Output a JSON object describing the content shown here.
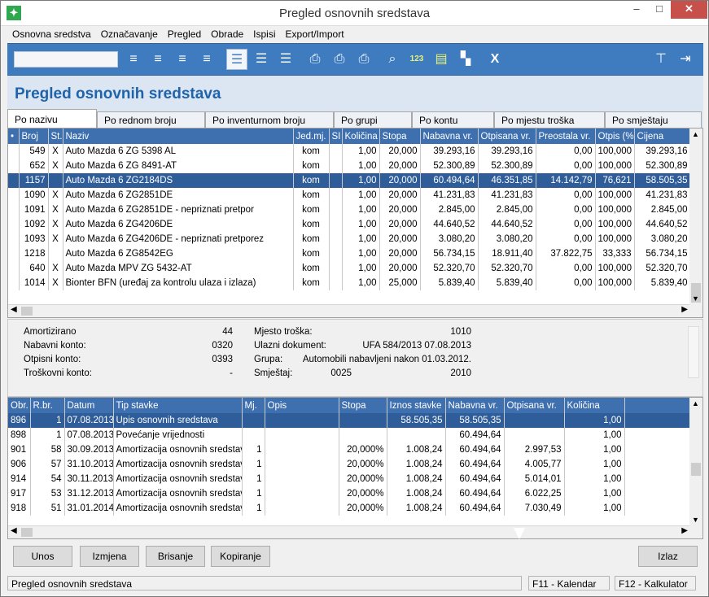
{
  "window": {
    "title": "Pregled osnovnih sredstava",
    "minimize": "–",
    "maximize": "□",
    "close": "✕"
  },
  "menu": [
    "Osnovna sredstva",
    "Označavanje",
    "Pregled",
    "Obrade",
    "Ispisi",
    "Export/Import"
  ],
  "toolbar": {
    "search_value": "",
    "icons": [
      "list-insert-icon",
      "list-add-icon",
      "list-delete-icon",
      "list-refresh-icon",
      "view-detail-icon",
      "view-list-icon",
      "view-compact-icon",
      "print-icon",
      "print-euro-icon",
      "print-sum-icon",
      "search-icon",
      "number-123-icon",
      "document-icon",
      "layout-icon",
      "excel-icon",
      "settings-icon",
      "exit-icon"
    ],
    "number_label": "123",
    "excel_label": "X"
  },
  "page_title": "Pregled osnovnih sredstava",
  "tabs": [
    {
      "label": "Po nazivu",
      "hotkey_index": 0,
      "active": true
    },
    {
      "label": "Po rednom broju",
      "active": false
    },
    {
      "label": "Po inventurnom broju",
      "active": false
    },
    {
      "label": "Po grupi",
      "active": false
    },
    {
      "label": "Po kontu",
      "active": false
    },
    {
      "label": "Po mjestu troška",
      "active": false
    },
    {
      "label": "Po smještaju",
      "active": false
    }
  ],
  "grid": {
    "columns": [
      "•",
      "Broj",
      "St.",
      "Naziv",
      "Jed.mj.",
      "SI",
      "Količina",
      "Stopa",
      "Nabavna vr.",
      "Otpisana vr.",
      "Preostala vr.",
      "Otpis (%)",
      "Cijena"
    ],
    "rows": [
      [
        "",
        "549",
        "X",
        "Auto Mazda 6 ZG 5398 AL",
        "kom",
        "",
        "1,00",
        "20,000",
        "39.293,16",
        "39.293,16",
        "0,00",
        "100,000",
        "39.293,16"
      ],
      [
        "",
        "652",
        "X",
        "Auto Mazda 6 ZG 8491-AT",
        "kom",
        "",
        "1,00",
        "20,000",
        "52.300,89",
        "52.300,89",
        "0,00",
        "100,000",
        "52.300,89"
      ],
      [
        "",
        "1157",
        "",
        "Auto Mazda 6 ZG2184DS",
        "kom",
        "",
        "1,00",
        "20,000",
        "60.494,64",
        "46.351,85",
        "14.142,79",
        "76,621",
        "58.505,35"
      ],
      [
        "",
        "1090",
        "X",
        "Auto Mazda 6 ZG2851DE",
        "kom",
        "",
        "1,00",
        "20,000",
        "41.231,83",
        "41.231,83",
        "0,00",
        "100,000",
        "41.231,83"
      ],
      [
        "",
        "1091",
        "X",
        "Auto Mazda 6 ZG2851DE - nepriznati pretpor",
        "kom",
        "",
        "1,00",
        "20,000",
        "2.845,00",
        "2.845,00",
        "0,00",
        "100,000",
        "2.845,00"
      ],
      [
        "",
        "1092",
        "X",
        "Auto Mazda 6 ZG4206DE",
        "kom",
        "",
        "1,00",
        "20,000",
        "44.640,52",
        "44.640,52",
        "0,00",
        "100,000",
        "44.640,52"
      ],
      [
        "",
        "1093",
        "X",
        "Auto Mazda 6 ZG4206DE - nepriznati pretporez",
        "kom",
        "",
        "1,00",
        "20,000",
        "3.080,20",
        "3.080,20",
        "0,00",
        "100,000",
        "3.080,20"
      ],
      [
        "",
        "1218",
        "",
        "Auto Mazda 6 ZG8542EG",
        "kom",
        "",
        "1,00",
        "20,000",
        "56.734,15",
        "18.911,40",
        "37.822,75",
        "33,333",
        "56.734,15"
      ],
      [
        "",
        "640",
        "X",
        "Auto Mazda MPV ZG 5432-AT",
        "kom",
        "",
        "1,00",
        "20,000",
        "52.320,70",
        "52.320,70",
        "0,00",
        "100,000",
        "52.320,70"
      ],
      [
        "",
        "1014",
        "X",
        "Bionter BFN (uređaj za kontrolu ulaza i izlaza)",
        "kom",
        "",
        "1,00",
        "25,000",
        "5.839,40",
        "5.839,40",
        "0,00",
        "100,000",
        "5.839,40"
      ]
    ],
    "selected_row": 2
  },
  "detail": {
    "left": [
      {
        "label": "Amortizirano",
        "value": "44"
      },
      {
        "label": "Nabavni konto:",
        "value": "0320"
      },
      {
        "label": "Otpisni konto:",
        "value": "0393"
      },
      {
        "label": "Troškovni konto:",
        "value": "-"
      }
    ],
    "mjesto_label": "Mjesto troška:",
    "mjesto_value": "1010",
    "ulazni_label": "Ulazni dokument:",
    "ulazni_value": "UFA 584/2013  07.08.2013",
    "grupa_label": "Grupa:",
    "grupa_value": "Automobili nabavljeni nakon 01.03.2012.",
    "smjestaj_label": "Smještaj:",
    "smjestaj_value": "0025",
    "smjestaj_year": "2010"
  },
  "grid2": {
    "columns": [
      "Obr.",
      "R.br.",
      "Datum",
      "Tip stavke",
      "Mj.",
      "Opis",
      "Stopa",
      "Iznos stavke",
      "Nabavna vr.",
      "Otpisana vr.",
      "Količina",
      ""
    ],
    "rows": [
      [
        "896",
        "1",
        "07.08.2013",
        "Upis osnovnih sredstava",
        "",
        "",
        "",
        "58.505,35",
        "58.505,35",
        "",
        "1,00",
        ""
      ],
      [
        "898",
        "1",
        "07.08.2013",
        "Povećanje vrijednosti",
        "",
        "",
        "",
        "",
        "60.494,64",
        "",
        "1,00",
        ""
      ],
      [
        "901",
        "58",
        "30.09.2013",
        "Amortizacija osnovnih sredstava",
        "1",
        "",
        "20,000%",
        "1.008,24",
        "60.494,64",
        "2.997,53",
        "1,00",
        ""
      ],
      [
        "906",
        "57",
        "31.10.2013",
        "Amortizacija osnovnih sredstava",
        "1",
        "",
        "20,000%",
        "1.008,24",
        "60.494,64",
        "4.005,77",
        "1,00",
        ""
      ],
      [
        "914",
        "54",
        "30.11.2013",
        "Amortizacija osnovnih sredstava",
        "1",
        "",
        "20,000%",
        "1.008,24",
        "60.494,64",
        "5.014,01",
        "1,00",
        ""
      ],
      [
        "917",
        "53",
        "31.12.2013",
        "Amortizacija osnovnih sredstava",
        "1",
        "",
        "20,000%",
        "1.008,24",
        "60.494,64",
        "6.022,25",
        "1,00",
        ""
      ],
      [
        "918",
        "51",
        "31.01.2014",
        "Amortizacija osnovnih sredstava",
        "1",
        "",
        "20,000%",
        "1.008,24",
        "60.494,64",
        "7.030,49",
        "1,00",
        ""
      ]
    ],
    "selected_row": 0
  },
  "buttons": {
    "unos": "Unos",
    "izmjena": "Izmjena",
    "brisanje": "Brisanje",
    "kopiranje": "Kopiranje",
    "izlaz": "Izlaz"
  },
  "status": {
    "left": "Pregled osnovnih sredstava",
    "f11": "F11 - Kalendar",
    "f12": "F12 - Kalkulator"
  },
  "colors": {
    "accent": "#3e7bbf",
    "header_blue": "#3e6fae",
    "selected": "#2e5d99",
    "title_blue": "#1f63aa"
  }
}
